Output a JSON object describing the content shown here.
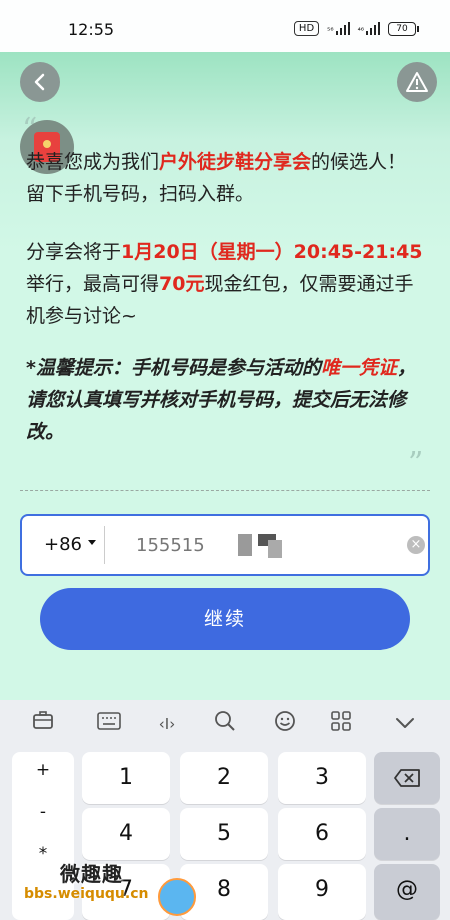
{
  "status": {
    "time": "12:55",
    "hd_badge": "HD",
    "signal1_label": "⁵⁶",
    "signal2_label": "⁴⁶",
    "battery": "70"
  },
  "header": {
    "back_icon": "chevron-left-icon",
    "alert_icon": "warning-triangle-icon"
  },
  "message": {
    "line1_part1": "恭喜您成为我们",
    "line1_highlight": "户外徒步鞋分享会",
    "line1_part2": "的候选人！",
    "line2": "留下手机号码，扫码入群。",
    "para2_part1": "分享会将于",
    "para2_highlight1": "1月20日（星期一）20:45-21:45",
    "para2_part2": "举行，最高可得",
    "para2_highlight2": "70元",
    "para2_part3": "现金红包，仅需要通过手机参与讨论~",
    "tip_part1": "*温馨提示：手机号码是参与活动的",
    "tip_highlight": "唯一凭证",
    "tip_part2": "，请您认真填写并核对手机号码，提交后无法修改。"
  },
  "form": {
    "country_code": "+86",
    "phone_value": "155515",
    "clear_icon": "clear-icon"
  },
  "continue_label": "继续",
  "keyboard": {
    "symbols": [
      "+",
      "-",
      "*"
    ],
    "keys": [
      "1",
      "2",
      "3",
      "4",
      "5",
      "6",
      "7",
      "8",
      "9"
    ],
    "backspace_icon": "backspace-icon",
    "dot": ".",
    "at": "@"
  },
  "watermark": {
    "top": "微趣趣",
    "bottom": "bbs.weiququ.cn"
  }
}
